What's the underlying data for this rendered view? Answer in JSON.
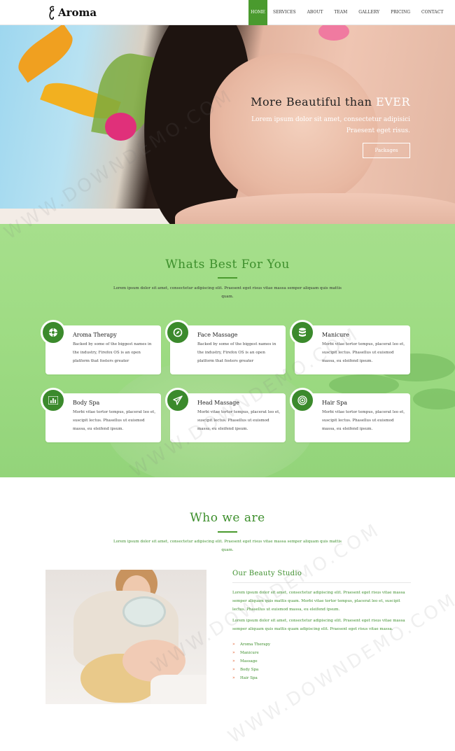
{
  "nav": {
    "logo_text": "Aroma",
    "menu": [
      "HOME",
      "SERVICES",
      "ABOUT",
      "TEAM",
      "GALLERY",
      "PRICING",
      "CONTACT"
    ],
    "active_index": 0
  },
  "hero": {
    "title_main": "More Beautiful than ",
    "title_accent": "EVER",
    "subtitle_line1": "Lorem ipsum dolor sit amet, consectetur adipisici",
    "subtitle_line2": "Praesent eget risus.",
    "button": "Packages"
  },
  "services": {
    "title": "Whats Best For You",
    "desc": "Lorem ipsum dolor sit amet, consectetur adipiscing elit. Praesent eget risus vitae massa semper aliquam quis mattis quam.",
    "cards": [
      {
        "title": "Aroma Therapy",
        "text": "Backed by some of the biggest names in the industry, Firefox OS is an open platform that fosters greater",
        "icon": "globe-icon"
      },
      {
        "title": "Face Massage",
        "text": "Backed by some of the biggest names in the industry, Firefox OS is an open platform that fosters greater",
        "icon": "compass-icon"
      },
      {
        "title": "Manicure",
        "text": "Morbi vitae tortor tempus, placerat leo et, suscipit lectus. Phasellus ut euismod massa, eu eleifend ipsum.",
        "icon": "database-icon"
      },
      {
        "title": "Body Spa",
        "text": "Morbi vitae tortor tempus, placerat leo et, suscipit lectus. Phasellus ut euismod massa, eu eleifend ipsum.",
        "icon": "bar-chart-icon"
      },
      {
        "title": "Head Massage",
        "text": "Morbi vitae tortor tempus, placerat leo et, suscipit lectus. Phasellus ut euismod massa, eu eleifend ipsum.",
        "icon": "paper-plane-icon"
      },
      {
        "title": "Hair Spa",
        "text": "Morbi vitae tortor tempus, placerat leo et, suscipit lectus. Phasellus ut euismod massa, eu eleifend ipsum.",
        "icon": "target-icon"
      }
    ]
  },
  "who": {
    "title": "Who we are",
    "desc": "Lorem ipsum dolor sit amet, consectetur adipiscing elit. Praesent eget risus vitae massa semper aliquam quis mattis quam.",
    "heading": "Our Beauty Studio",
    "para1": "Lorem ipsum dolor sit amet, consectetur adipiscing elit. Praesent eget risus vitae massa semper aliquam quis mattis quam. Morbi vitae tortor tempus, placerat leo et, suscipit lectus. Phasellus ut euismod massa, eu eleifend ipsum.",
    "para2": "Lorem ipsum dolor sit amet, consectetur adipiscing elit. Praesent eget risus vitae massa semper aliquam quis mattis quam adipiscing elit. Praesent eget risus vitae massa.",
    "list": [
      "Aroma Therapy",
      "Manicure",
      "Massage",
      "Body Spa",
      "Hair Spa"
    ]
  },
  "watermark": "WWW.DOWNDEMO.COM",
  "colors": {
    "accent": "#4a9a2e",
    "section_bg": "#a6df8c",
    "bullet": "#e05b2b"
  }
}
